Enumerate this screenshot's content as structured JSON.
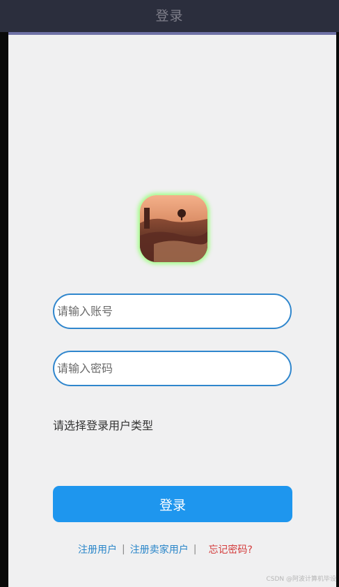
{
  "header": {
    "title": "登录"
  },
  "avatar": {
    "icon": "landscape-avatar"
  },
  "form": {
    "account_placeholder": "请输入账号",
    "password_placeholder": "请输入密码",
    "usertype_label": "请选择登录用户类型",
    "login_label": "登录"
  },
  "links": {
    "register_user": "注册用户",
    "separator": "|",
    "register_seller": "注册卖家用户",
    "forgot_password": "忘记密码?"
  },
  "watermark": {
    "text": "CSDN @阿波计算机毕设"
  },
  "colors": {
    "accent": "#1e96ee",
    "input_border": "#2f86cd",
    "link": "#2a86c9",
    "link_warning": "#d33a3a"
  }
}
